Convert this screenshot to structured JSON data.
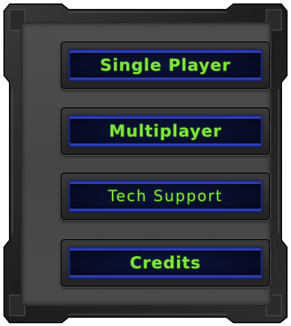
{
  "menu": {
    "buttons": [
      {
        "label": "Single Player"
      },
      {
        "label": "Multiplayer"
      },
      {
        "label": "Tech Support"
      },
      {
        "label": "Credits"
      }
    ]
  },
  "colors": {
    "label_green": "#7ee33f",
    "button_face": "#070c25",
    "button_border_blue": "#2e3fb4",
    "panel_gray": "#4b4b4b",
    "frame_dark": "#1a1a1a"
  }
}
